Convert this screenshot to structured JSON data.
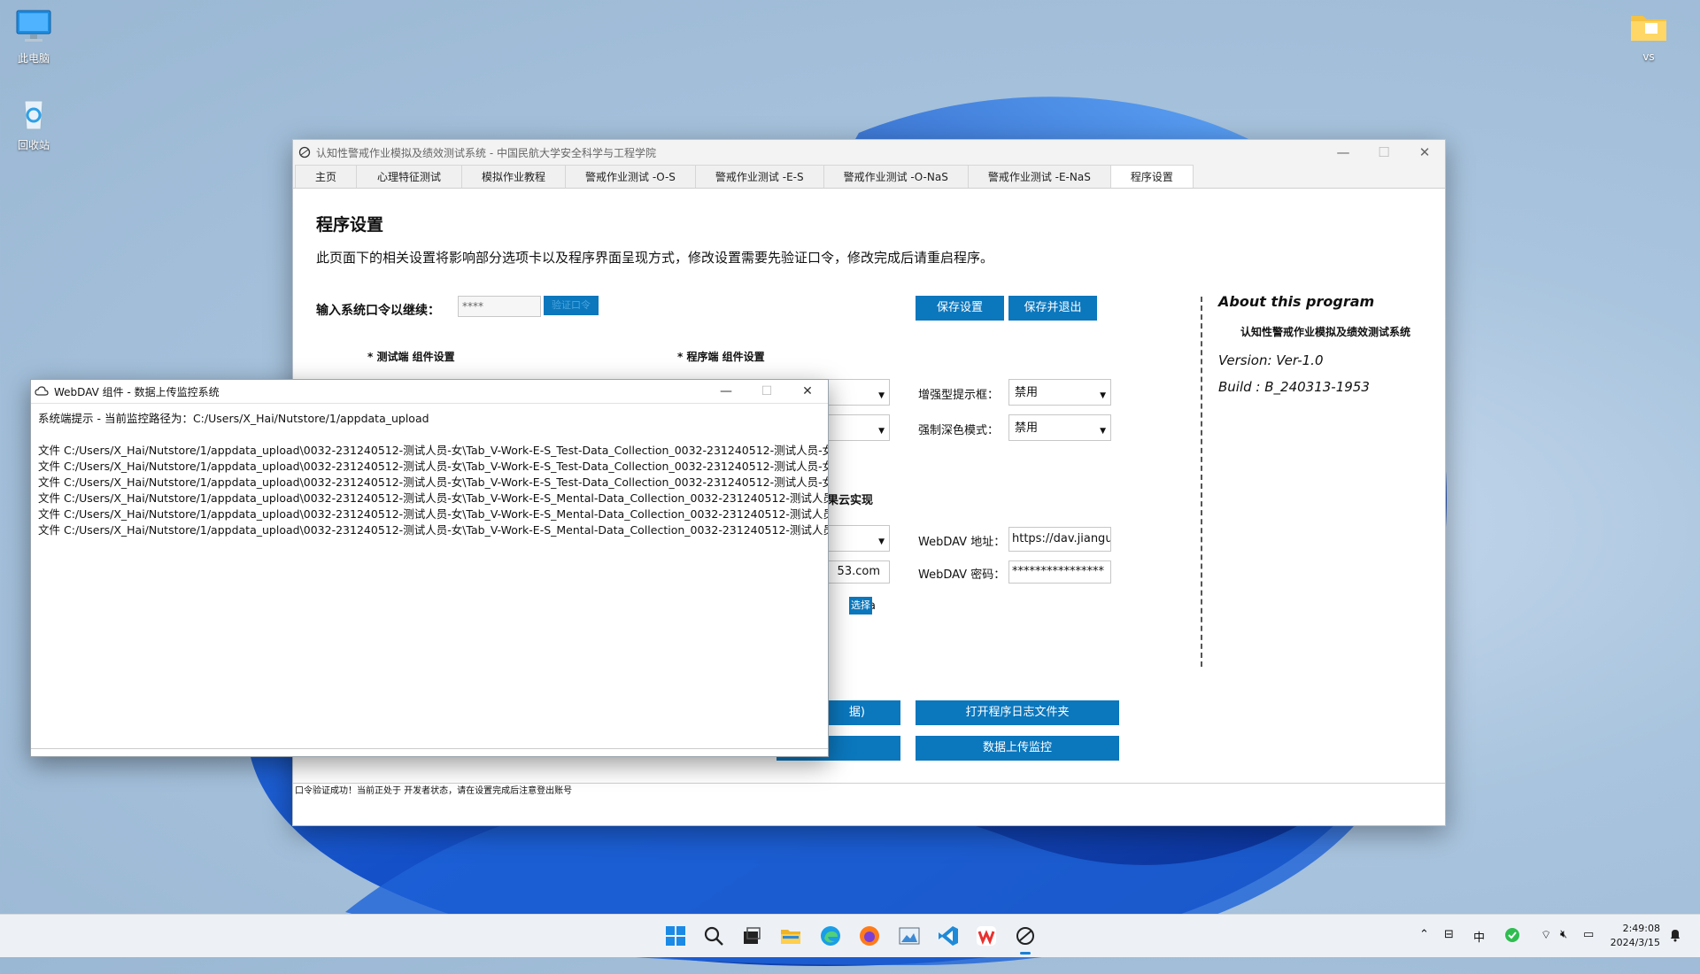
{
  "desktop": {
    "icons": [
      {
        "label": "此电脑"
      },
      {
        "label": "回收站"
      },
      {
        "label": "vs"
      }
    ]
  },
  "main_window": {
    "title": "认知性警戒作业模拟及绩效测试系统 - 中国民航大学安全科学与工程学院",
    "tabs": [
      "主页",
      "心理特征测试",
      "模拟作业教程",
      "警戒作业测试 -O-S",
      "警戒作业测试 -E-S",
      "警戒作业测试 -O-NaS",
      "警戒作业测试 -E-NaS",
      "程序设置"
    ],
    "active_tab": "程序设置",
    "heading": "程序设置",
    "description": "此页面下的相关设置将影响部分选项卡以及程序界面呈现方式，修改设置需要先验证口令，修改完成后请重启程序。",
    "password_label": "输入系统口令以继续：",
    "password_value": "****",
    "verify_button": "验证口令",
    "save_button": "保存设置",
    "save_exit_button": "保存并退出",
    "section_tester": "* 测试端 组件设置",
    "section_program": "* 程序端 组件设置",
    "enhanced_prompt_label": "增强型提示框：",
    "enhanced_prompt_value": "禁用",
    "dark_mode_label": "强制深色模式：",
    "dark_mode_value": "禁用",
    "cloud_fragment": "果云实现",
    "email_fragment": "53.com",
    "path_fragment": "_Ha",
    "choose_button": "选择",
    "webdav_addr_label": "WebDAV 地址：",
    "webdav_addr_value": "https://dav.jianguo",
    "webdav_pwd_label": "WebDAV 密码：",
    "webdav_pwd_value": "****************",
    "data_btn_fragment": "据)",
    "open_log_button": "打开程序日志文件夹",
    "upload_monitor_button": "数据上传监控",
    "about_heading": "About this program",
    "about_name": "认知性警戒作业模拟及绩效测试系统",
    "about_version": "Version:  Ver-1.0",
    "about_build": "Build :  B_240313-1953",
    "status": "口令验证成功！当前正处于 开发者状态，请在设置完成后注意登出账号"
  },
  "webdav_window": {
    "title": "WebDAV 组件 - 数据上传监控系统",
    "lines": [
      "系统端提示 - 当前监控路径为：C:/Users/X_Hai/Nutstore/1/appdata_upload",
      "",
      "文件 C:/Users/X_Hai/Nutstore/1/appdata_upload\\0032-231240512-测试人员-女\\Tab_V-Work-E-S_Test-Data_Collection_0032-231240512-测试人员-女-",
      "文件 C:/Users/X_Hai/Nutstore/1/appdata_upload\\0032-231240512-测试人员-女\\Tab_V-Work-E-S_Test-Data_Collection_0032-231240512-测试人员-女-",
      "文件 C:/Users/X_Hai/Nutstore/1/appdata_upload\\0032-231240512-测试人员-女\\Tab_V-Work-E-S_Test-Data_Collection_0032-231240512-测试人员-女-",
      "文件 C:/Users/X_Hai/Nutstore/1/appdata_upload\\0032-231240512-测试人员-女\\Tab_V-Work-E-S_Mental-Data_Collection_0032-231240512-测试人员-",
      "文件 C:/Users/X_Hai/Nutstore/1/appdata_upload\\0032-231240512-测试人员-女\\Tab_V-Work-E-S_Mental-Data_Collection_0032-231240512-测试人员-",
      "文件 C:/Users/X_Hai/Nutstore/1/appdata_upload\\0032-231240512-测试人员-女\\Tab_V-Work-E-S_Mental-Data_Collection_0032-231240512-测试人员-"
    ]
  },
  "taskbar": {
    "ime": "中",
    "time": "2:49:08",
    "date": "2024/3/15",
    "colors": {
      "accent": "#0b77bd",
      "taskbar": "#edf1f6"
    }
  }
}
